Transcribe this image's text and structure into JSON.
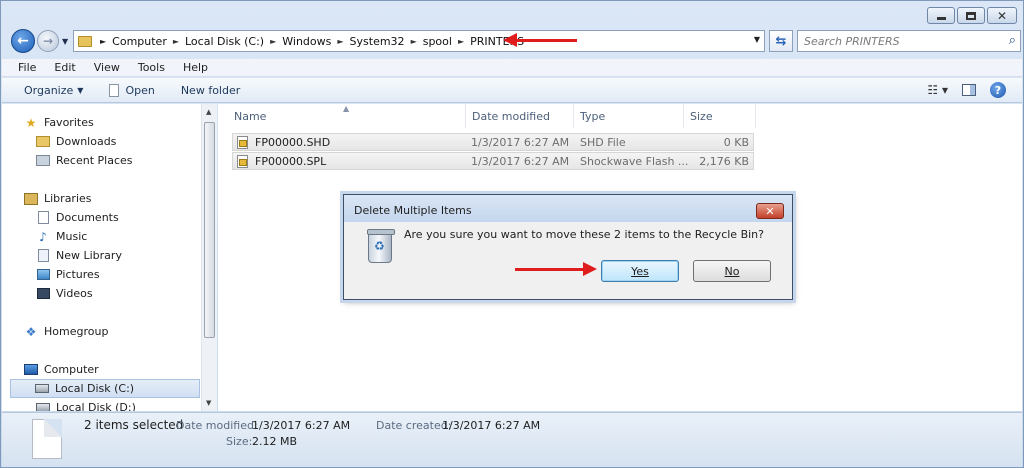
{
  "window": {
    "caption_buttons": {
      "minimize": "minimize-icon",
      "maximize": "maximize-icon",
      "close": "close-icon"
    }
  },
  "address": {
    "breadcrumbs": [
      "Computer",
      "Local Disk (C:)",
      "Windows",
      "System32",
      "spool",
      "PRINTERS"
    ],
    "search_placeholder": "Search PRINTERS"
  },
  "menu": [
    "File",
    "Edit",
    "View",
    "Tools",
    "Help"
  ],
  "toolbar": {
    "organize": "Organize",
    "open": "Open",
    "new_folder": "New folder"
  },
  "nav": {
    "items": [
      {
        "label": "Favorites",
        "icon": "star-icon"
      },
      {
        "label": "Downloads",
        "icon": "downloads-folder-icon"
      },
      {
        "label": "Recent Places",
        "icon": "recent-places-icon"
      },
      {
        "label": "Libraries",
        "icon": "libraries-icon"
      },
      {
        "label": "Documents",
        "icon": "documents-icon"
      },
      {
        "label": "Music",
        "icon": "music-icon"
      },
      {
        "label": "New Library",
        "icon": "library-icon"
      },
      {
        "label": "Pictures",
        "icon": "pictures-icon"
      },
      {
        "label": "Videos",
        "icon": "videos-icon"
      },
      {
        "label": "Homegroup",
        "icon": "homegroup-icon"
      },
      {
        "label": "Computer",
        "icon": "computer-icon"
      },
      {
        "label": "Local Disk (C:)",
        "icon": "disk-icon"
      },
      {
        "label": "Local Disk (D:)",
        "icon": "disk-icon"
      }
    ],
    "selected": "Local Disk (C:)"
  },
  "files": {
    "columns": [
      "Name",
      "Date modified",
      "Type",
      "Size"
    ],
    "rows": [
      {
        "name": "FP00000.SHD",
        "date": "1/3/2017 6:27 AM",
        "type": "SHD File",
        "size": "0 KB"
      },
      {
        "name": "FP00000.SPL",
        "date": "1/3/2017 6:27 AM",
        "type": "Shockwave Flash ...",
        "size": "2,176 KB"
      }
    ]
  },
  "dialog": {
    "title": "Delete Multiple Items",
    "message": "Are you sure you want to move these 2 items to the Recycle Bin?",
    "yes_label": "Yes",
    "no_label": "No"
  },
  "details": {
    "selection": "2 items selected",
    "date_modified_label": "Date modified:",
    "date_modified": "1/3/2017 6:27 AM",
    "date_created_label": "Date created:",
    "date_created": "1/3/2017 6:27 AM",
    "size_label": "Size:",
    "size": "2.12 MB"
  },
  "colors": {
    "accent_arrow": "#e01d1d",
    "window_frame": "#c4d7ee"
  }
}
